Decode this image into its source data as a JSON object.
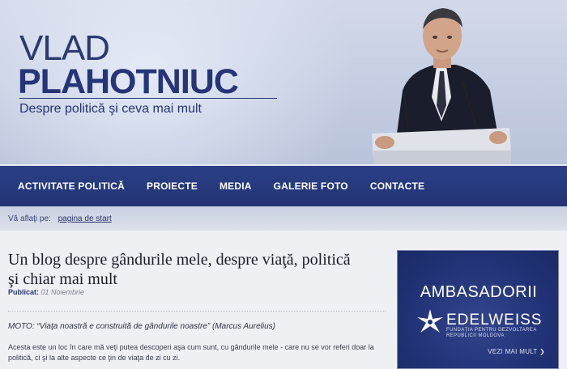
{
  "header": {
    "first_name": "VLAD",
    "last_name": "PLAHOTNIUC",
    "tagline": "Despre politică şi ceva mai mult"
  },
  "nav": {
    "items": [
      {
        "label": "ACTIVITATE POLITICĂ"
      },
      {
        "label": "PROIECTE"
      },
      {
        "label": "MEDIA"
      },
      {
        "label": "GALERIE FOTO"
      },
      {
        "label": "CONTACTE"
      }
    ]
  },
  "breadcrumb": {
    "prefix": "Vă aflaţi pe:",
    "link": "pagina de start"
  },
  "post": {
    "title": "Un blog despre gândurile mele, despre viaţă, politică şi chiar mai mult",
    "published_label": "Publicat:",
    "published_date": "01 Noiembrie",
    "moto": "MOTO: “Viaţa noastră e construită de gândurile noastre” (Marcus Aurelius)",
    "body": "Acesta este un loc în care mă veţi putea descoperi aşa cum sunt, cu gândurile mele - care nu se vor referi doar la politică, ci şi la alte aspecte ce ţin de viaţa de zi cu zi."
  },
  "ad": {
    "title": "AMBASADORII",
    "brand": "EDELWEISS",
    "subtitle": "FUNDAȚIA PENTRU DEZVOLTAREA REPUBLICII MOLDOVA",
    "more": "VEZI MAI MULT ❯"
  },
  "colors": {
    "nav_bg": "#223474",
    "brand_text": "#253577",
    "ad_bg": "#213276"
  }
}
